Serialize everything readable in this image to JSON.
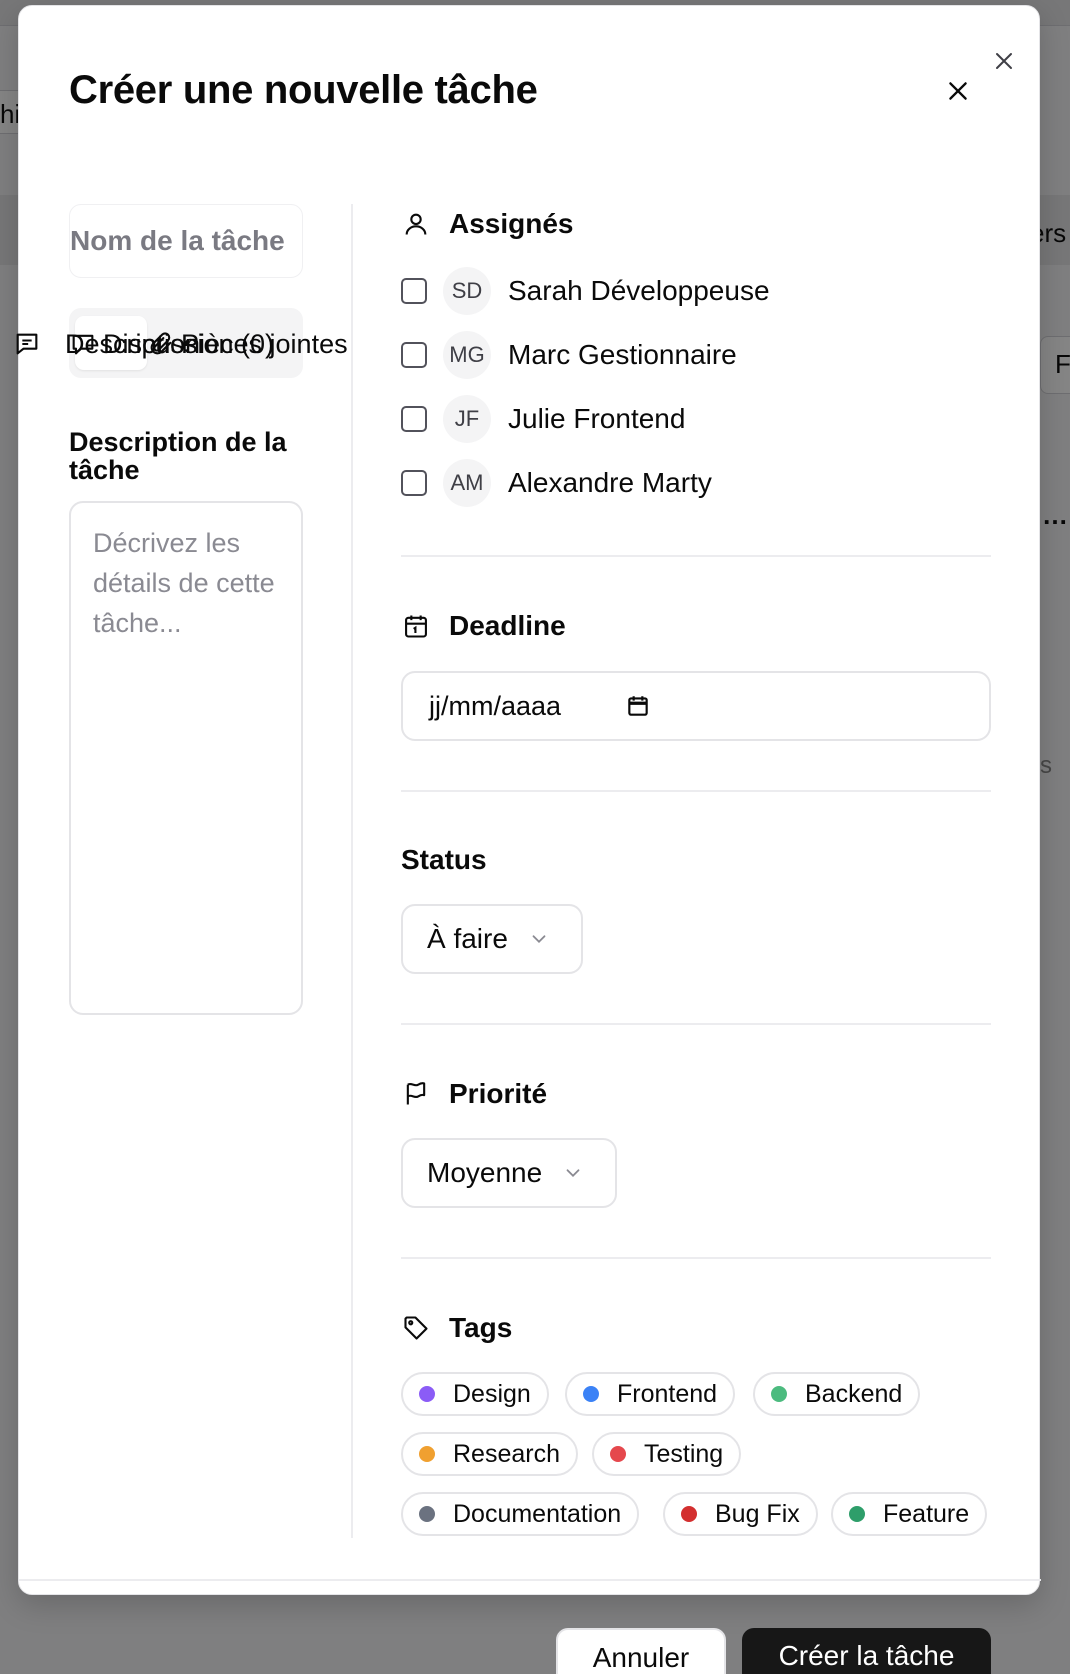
{
  "background": {
    "left_fragment": "hi",
    "right_fragment_1": "ers",
    "right_fragment_2": "F",
    "right_fragment_3": "…",
    "right_fragment_4": "s"
  },
  "modal": {
    "title": "Créer une nouvelle tâche",
    "task_name_placeholder": "Nom de la tâche",
    "tabs": [
      {
        "label": "Description",
        "icon": "message-square-icon",
        "active": true
      },
      {
        "label": "Discussion (0)",
        "icon": "message-circle-icon",
        "active": false
      },
      {
        "label": "Pièces jointes",
        "icon": "paperclip-icon",
        "active": false
      }
    ],
    "description": {
      "label": "Description de la tâche",
      "placeholder": "Décrivez les détails de cette tâche..."
    },
    "assignees": {
      "label": "Assignés",
      "items": [
        {
          "initials": "SD",
          "name": "Sarah Développeuse",
          "checked": false
        },
        {
          "initials": "MG",
          "name": "Marc Gestionnaire",
          "checked": false
        },
        {
          "initials": "JF",
          "name": "Julie Frontend",
          "checked": false
        },
        {
          "initials": "AM",
          "name": "Alexandre Marty",
          "checked": false
        }
      ]
    },
    "deadline": {
      "label": "Deadline",
      "placeholder": "jj/mm/aaaa"
    },
    "status": {
      "label": "Status",
      "value": "À faire"
    },
    "priority": {
      "label": "Priorité",
      "value": "Moyenne"
    },
    "tags": {
      "label": "Tags",
      "items": [
        {
          "label": "Design",
          "color": "#8b5cf6"
        },
        {
          "label": "Frontend",
          "color": "#3b82f6"
        },
        {
          "label": "Backend",
          "color": "#4cbb7f"
        },
        {
          "label": "Research",
          "color": "#f0a030"
        },
        {
          "label": "Testing",
          "color": "#e5484d"
        },
        {
          "label": "Documentation",
          "color": "#6b7280"
        },
        {
          "label": "Bug Fix",
          "color": "#d32f2f"
        },
        {
          "label": "Feature",
          "color": "#2e9e6a"
        }
      ]
    }
  },
  "footer": {
    "cancel_label": "Annuler",
    "create_label": "Créer la tâche"
  }
}
